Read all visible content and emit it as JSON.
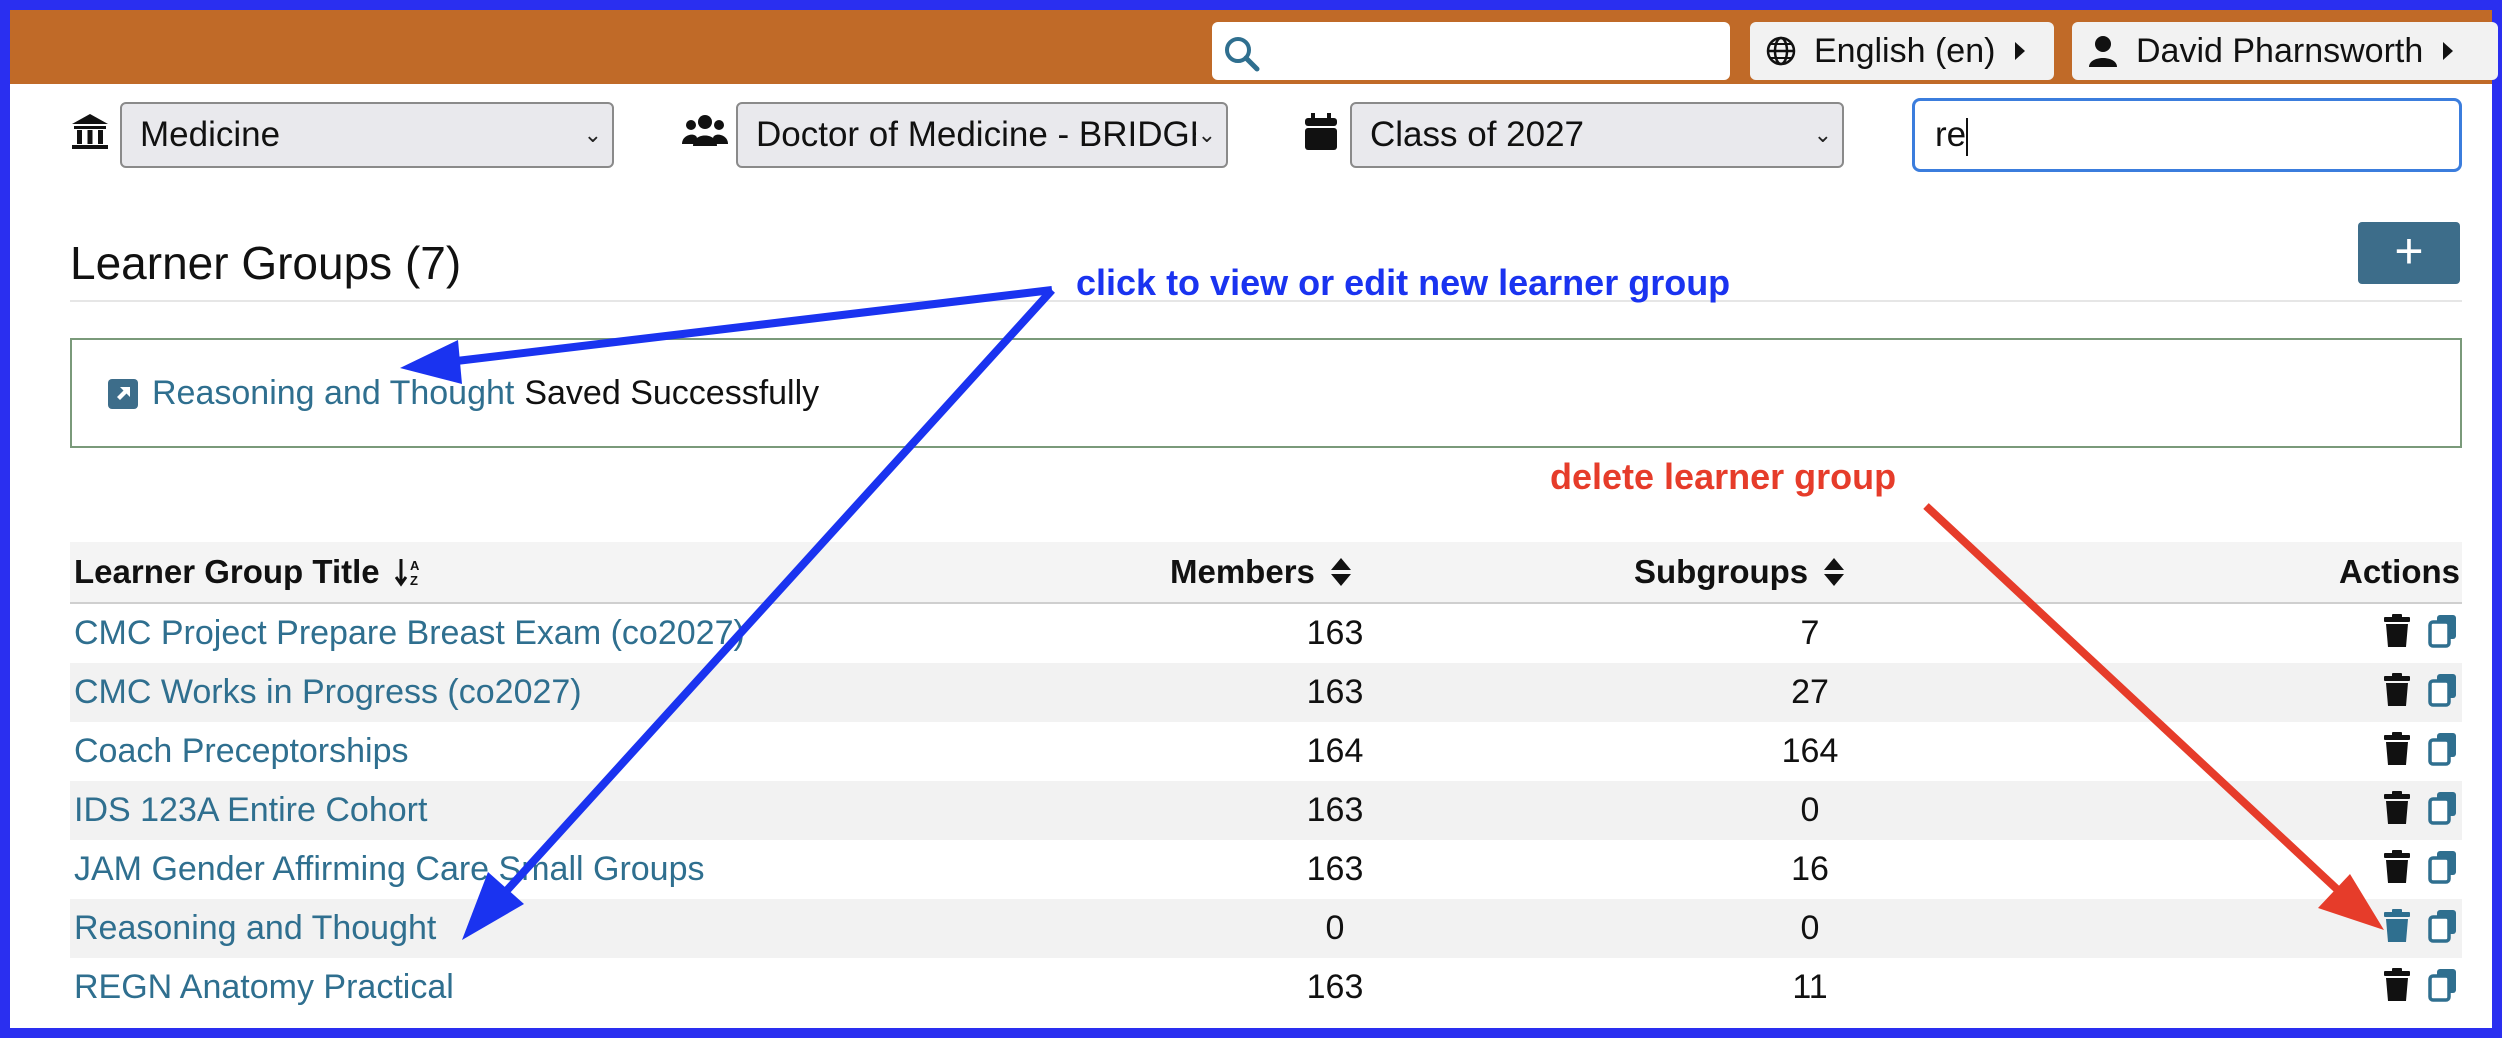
{
  "header": {
    "search_value": "",
    "language_label": "English (en)",
    "user_name": "David Pharnsworth",
    "bar_color": "#c06a28"
  },
  "filters": {
    "school": "Medicine",
    "program": "Doctor of Medicine - BRIDGE",
    "cohort": "Class of 2027",
    "title_filter": "re"
  },
  "page": {
    "heading": "Learner Groups (7)",
    "add_label": "+"
  },
  "alert": {
    "link_text": "Reasoning and Thought",
    "message": "Saved Successfully"
  },
  "table": {
    "headers": {
      "title": "Learner Group Title",
      "members": "Members",
      "subgroups": "Subgroups",
      "actions": "Actions"
    },
    "rows": [
      {
        "title": "CMC Project Prepare Breast Exam (co2027)",
        "members": "163",
        "subgroups": "7"
      },
      {
        "title": "CMC Works in Progress (co2027)",
        "members": "163",
        "subgroups": "27"
      },
      {
        "title": "Coach Preceptorships",
        "members": "164",
        "subgroups": "164"
      },
      {
        "title": "IDS 123A Entire Cohort",
        "members": "163",
        "subgroups": "0"
      },
      {
        "title": "JAM Gender Affirming Care Small Groups",
        "members": "163",
        "subgroups": "16"
      },
      {
        "title": "Reasoning and Thought",
        "members": "0",
        "subgroups": "0"
      },
      {
        "title": "REGN Anatomy Practical",
        "members": "163",
        "subgroups": "11"
      }
    ]
  },
  "annotations": {
    "view_edit": "click to view or edit new learner group",
    "delete": "delete learner group",
    "blue_color": "#1a33f0",
    "red_color": "#e63c2a"
  }
}
